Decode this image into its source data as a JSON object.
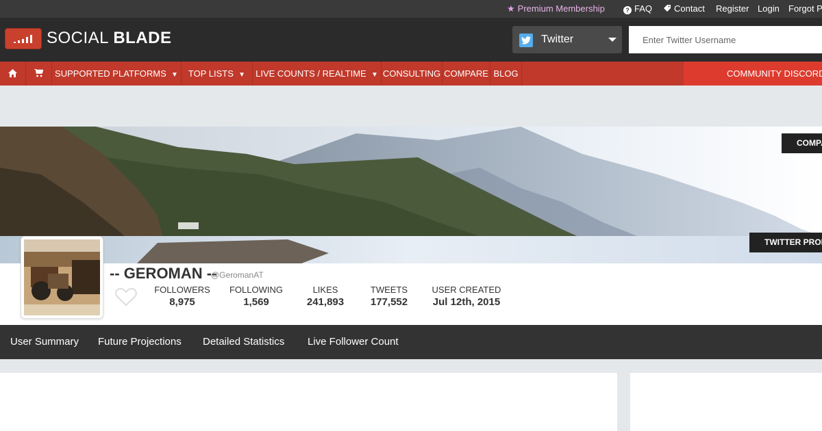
{
  "topbar": {
    "premium": "Premium Membership",
    "faq": "FAQ",
    "contact": "Contact",
    "register": "Register",
    "login": "Login",
    "forgot": "Forgot Password"
  },
  "header": {
    "logo_light": "SOCIAL ",
    "logo_bold": "BLADE",
    "platform": "Twitter",
    "search_placeholder": "Enter Twitter Username"
  },
  "nav": {
    "supported": "SUPPORTED PLATFORMS",
    "toplists": "TOP LISTS",
    "livecounts": "LIVE COUNTS / REALTIME",
    "consulting": "CONSULTING",
    "compare": "COMPARE",
    "blog": "BLOG",
    "community": "COMMUNITY DISCORD",
    "dropdown_caret": "▼"
  },
  "banner": {
    "compare_button": "COMPARE",
    "profile_button": "TWITTER PROFILE"
  },
  "profile": {
    "display_name": "-- GEROMAN --",
    "handle": "@GeromanAT",
    "stats": {
      "followers_label": "FOLLOWERS",
      "followers": "8,975",
      "following_label": "FOLLOWING",
      "following": "1,569",
      "likes_label": "LIKES",
      "likes": "241,893",
      "tweets_label": "TWEETS",
      "tweets": "177,552",
      "created_label": "USER CREATED",
      "created": "Jul 12th, 2015"
    }
  },
  "subnav": {
    "summary": "User Summary",
    "projections": "Future Projections",
    "detailed": "Detailed Statistics",
    "live": "Live Follower Count"
  },
  "colors": {
    "brand_red": "#c0392b",
    "dark": "#2b2b2b",
    "twitter_blue": "#55acee"
  }
}
